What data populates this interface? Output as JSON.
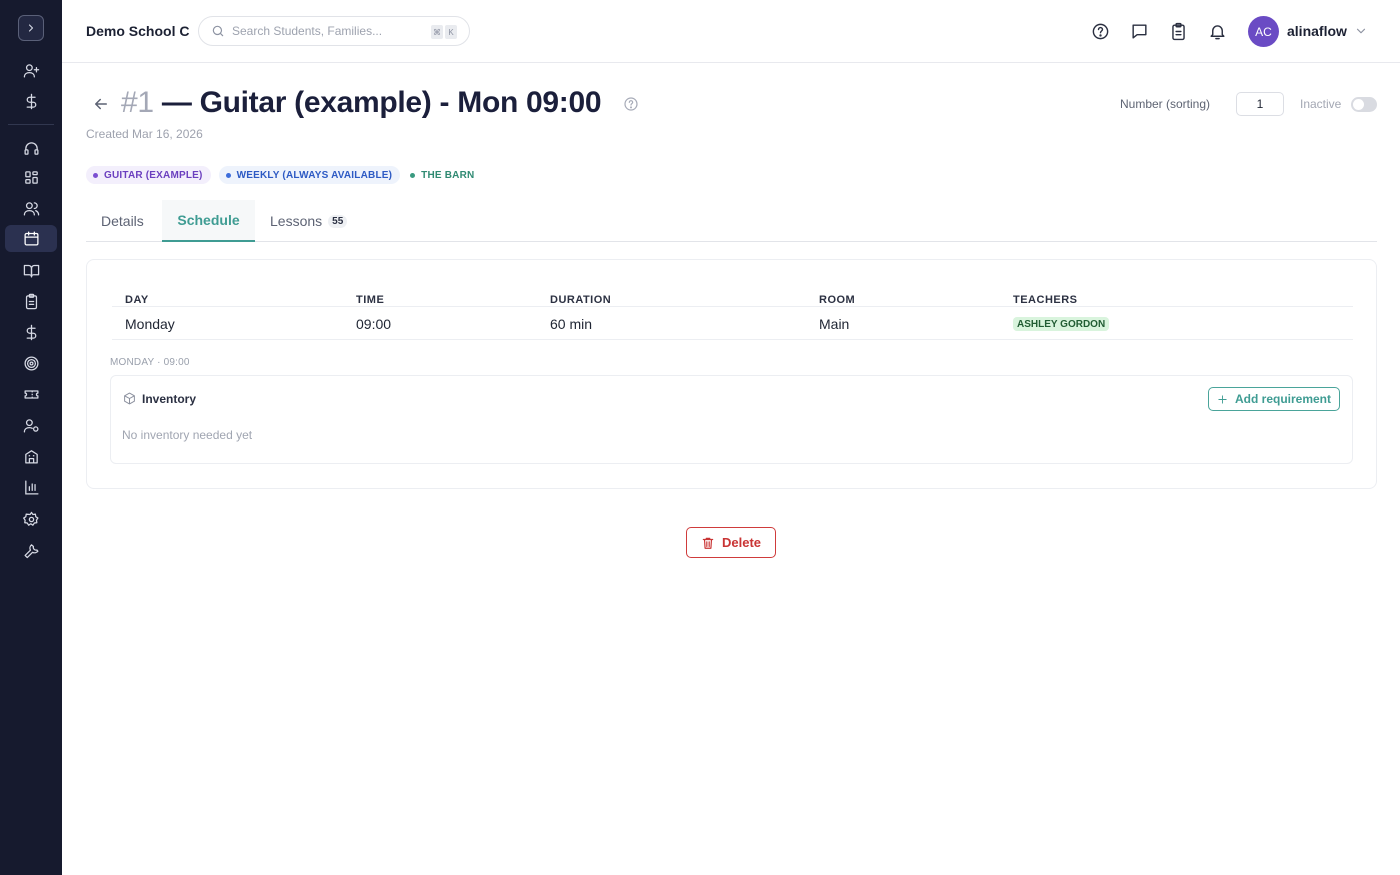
{
  "topbar": {
    "school_name": "Demo School C",
    "search_placeholder": "Search Students, Families...",
    "shortcut_keys": [
      "⌘",
      "K"
    ],
    "user_initials": "AC",
    "username": "alinaflow"
  },
  "sidebar": {
    "items": [
      {
        "icon": "user-plus-icon"
      },
      {
        "icon": "dollar-icon"
      },
      {
        "icon": "headset-icon"
      },
      {
        "icon": "dashboard-grid-icon"
      },
      {
        "icon": "users-icon"
      },
      {
        "icon": "calendar-icon",
        "active": true
      },
      {
        "icon": "book-icon"
      },
      {
        "icon": "clipboard-icon"
      },
      {
        "icon": "dollar-icon"
      },
      {
        "icon": "target-icon"
      },
      {
        "icon": "ticket-icon"
      },
      {
        "icon": "user-settings-icon"
      },
      {
        "icon": "building-icon"
      },
      {
        "icon": "bar-chart-icon"
      },
      {
        "icon": "gear-icon"
      },
      {
        "icon": "wrench-icon"
      }
    ]
  },
  "header": {
    "title_number": "#1",
    "title_text": "— Guitar (example) - Mon 09:00",
    "created": "Created Mar 16, 2026",
    "sorting_label": "Number (sorting)",
    "sorting_value": "1",
    "inactive_label": "Inactive"
  },
  "tags": [
    {
      "label": "GUITAR (EXAMPLE)",
      "color": "#6b3fbf"
    },
    {
      "label": "WEEKLY (ALWAYS AVAILABLE)",
      "color": "#2d5ac4"
    },
    {
      "label": "THE BARN",
      "color": "#2f8a72"
    }
  ],
  "tabs": [
    {
      "label": "Details"
    },
    {
      "label": "Schedule",
      "active": true
    },
    {
      "label": "Lessons",
      "count": "55"
    }
  ],
  "schedule": {
    "columns": [
      "DAY",
      "TIME",
      "DURATION",
      "ROOM",
      "TEACHERS"
    ],
    "rows": [
      {
        "day": "Monday",
        "time": "09:00",
        "duration": "60 min",
        "room": "Main",
        "teacher": "ASHLEY GORDON"
      }
    ],
    "slot_label": "MONDAY · 09:00",
    "inventory_title": "Inventory",
    "inventory_empty": "No inventory needed yet",
    "add_requirement": "Add requirement"
  },
  "actions": {
    "delete": "Delete"
  },
  "colors": {
    "accent": "#3f9c93",
    "sidebar_bg": "#161a2e",
    "danger": "#c93434",
    "avatar": "#6a4bc4"
  }
}
